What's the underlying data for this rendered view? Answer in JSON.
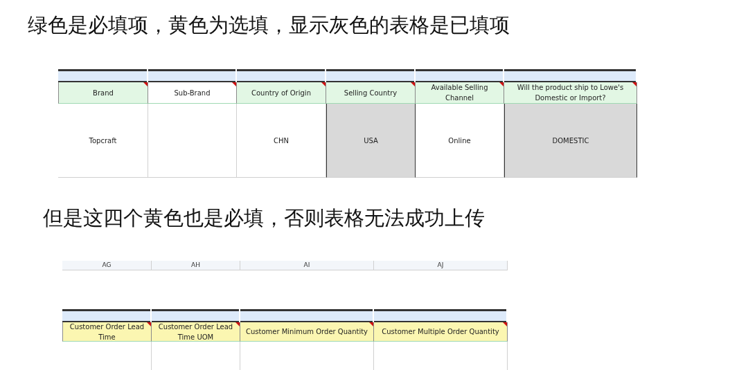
{
  "heading_1": "绿色是必填项，黄色为选填，显示灰色的表格是已填项",
  "table_1": {
    "columns": [
      {
        "header": {
          "label": "Brand",
          "color": "#e2f7e4",
          "comment": true
        },
        "cell": {
          "text": "Topcraft",
          "color": "#ffffff"
        }
      },
      {
        "header": {
          "label": "Sub-Brand",
          "color": "#ffffff",
          "comment": true
        },
        "cell": {
          "color": "#ffffff"
        }
      },
      {
        "header": {
          "label": "Country of Origin",
          "color": "#e2f7e4",
          "comment": true
        },
        "cell": {
          "text": "CHN",
          "color": "#ffffff"
        }
      },
      {
        "header": {
          "label": "Selling Country",
          "color": "#e2f7e4",
          "comment": true
        },
        "cell": {
          "text": "USA",
          "color": "#d9d9d9"
        }
      },
      {
        "header": {
          "label": "Available Selling Channel",
          "color": "#e2f7e4",
          "comment": true
        },
        "cell": {
          "text": "Online",
          "color": "#ffffff"
        }
      },
      {
        "header": {
          "label": "Will the product ship to Lowe's Domestic or Import?",
          "color": "#e2f7e4",
          "comment": true
        },
        "cell": {
          "text": "DOMESTIC",
          "color": "#d9d9d9"
        }
      }
    ]
  },
  "heading_2": "但是这四个黄色也是必填，否则表格无法成功上传",
  "table_2": {
    "columns": [
      {
        "letter": "AG",
        "header": {
          "label": "Customer Order Lead Time",
          "color": "#fbf6b1",
          "comment": true
        }
      },
      {
        "letter": "AH",
        "header": {
          "label": "Customer Order Lead Time UOM",
          "color": "#fbf6b1",
          "comment": true
        }
      },
      {
        "letter": "AI",
        "header": {
          "label": "Customer Minimum Order Quantity",
          "color": "#fbf6b1",
          "comment": true
        }
      },
      {
        "letter": "AJ",
        "header": {
          "label": "Customer Multiple Order Quantity",
          "color": "#fbf6b1",
          "comment": true
        }
      }
    ]
  }
}
